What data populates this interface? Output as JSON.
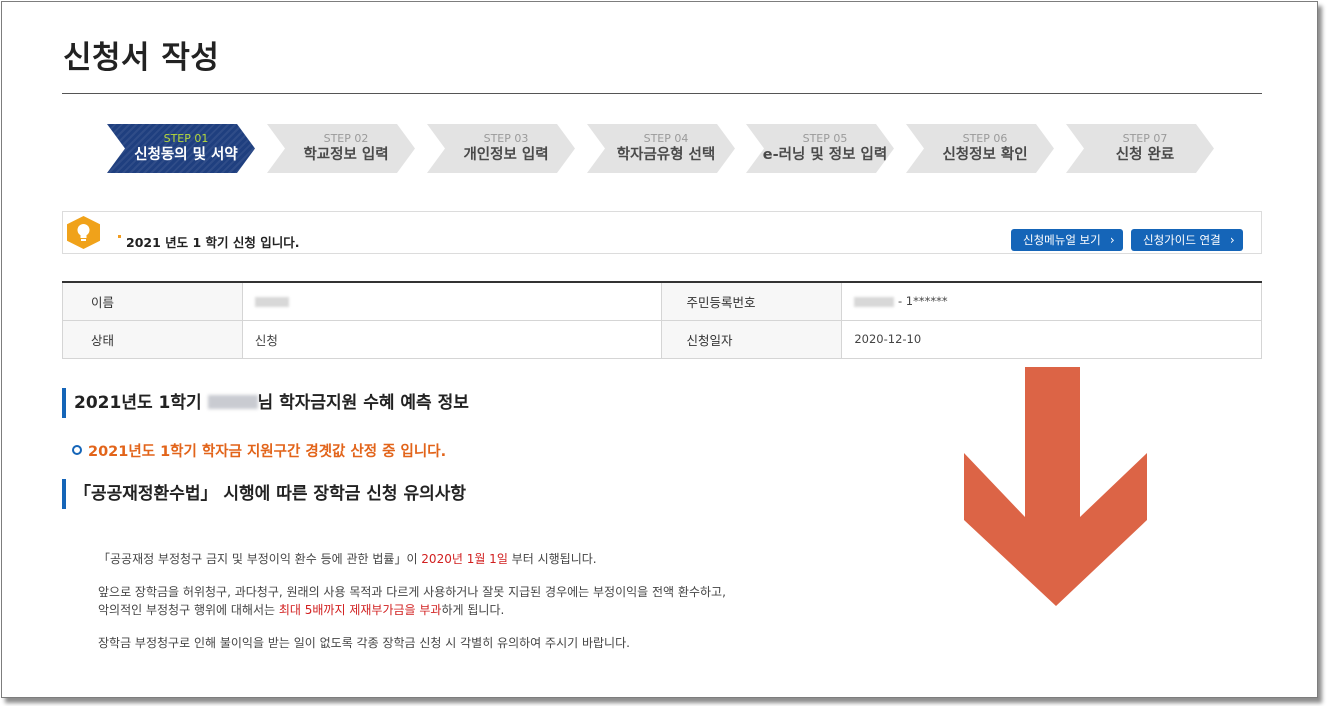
{
  "page": {
    "title": "신청서 작성"
  },
  "steps": [
    {
      "num": "STEP 01",
      "label": "신청동의 및 서약",
      "active": true
    },
    {
      "num": "STEP 02",
      "label": "학교정보 입력",
      "active": false
    },
    {
      "num": "STEP 03",
      "label": "개인정보 입력",
      "active": false
    },
    {
      "num": "STEP 04",
      "label": "학자금유형 선택",
      "active": false
    },
    {
      "num": "STEP 05",
      "label": "e-러닝 및 정보 입력",
      "active": false
    },
    {
      "num": "STEP 06",
      "label": "신청정보 확인",
      "active": false
    },
    {
      "num": "STEP 07",
      "label": "신청 완료",
      "active": false
    }
  ],
  "notice": {
    "icon": "lightbulb-icon",
    "text": "2021 년도 1 학기 신청 입니다.",
    "manual_button": "신청메뉴얼 보기",
    "guide_button": "신청가이드 연결"
  },
  "info": {
    "name_label": "이름",
    "rrn_label": "주민등록번호",
    "rrn_suffix": "- 1******",
    "status_label": "상태",
    "status_value": "신청",
    "date_label": "신청일자",
    "date_value": "2020-12-10"
  },
  "prediction": {
    "heading_prefix": "2021년도 1학기",
    "heading_suffix": "님 학자금지원 수혜 예측 정보",
    "bullet": "2021년도 1학기 학자금 지원구간 경곗값 산정 중 입니다."
  },
  "notes": {
    "heading": "「공공재정환수법」 시행에 따른 장학금 신청 유의사항",
    "p1_a": "「공공재정 부정청구 금지 및 부정이익 환수 등에 관한 법률」이 ",
    "p1_red": "2020년 1월 1일",
    "p1_b": " 부터 시행됩니다.",
    "p2_line1": "앞으로 장학금을 허위청구, 과다청구, 원래의 사용 목적과 다르게 사용하거나 잘못 지급된 경우에는 부정이익을 전액 환수하고,",
    "p2_line2_a": "악의적인 부정청구 행위에 대해서는 ",
    "p2_line2_red": "최대 5배까지 제재부가금을 부과",
    "p2_line2_b": "하게 됩니다.",
    "p3": "장학금 부정청구로 인해 불이익을 받는 일이 없도록 각종 장학금 신청 시 각별히 유의하여 주시기 바랍니다."
  },
  "colors": {
    "accent_blue": "#1565b8",
    "step_active": "#1f3f7f",
    "warning_orange": "#e2641a",
    "arrow": "#dc6446",
    "highlight_red": "#d11f1f"
  }
}
